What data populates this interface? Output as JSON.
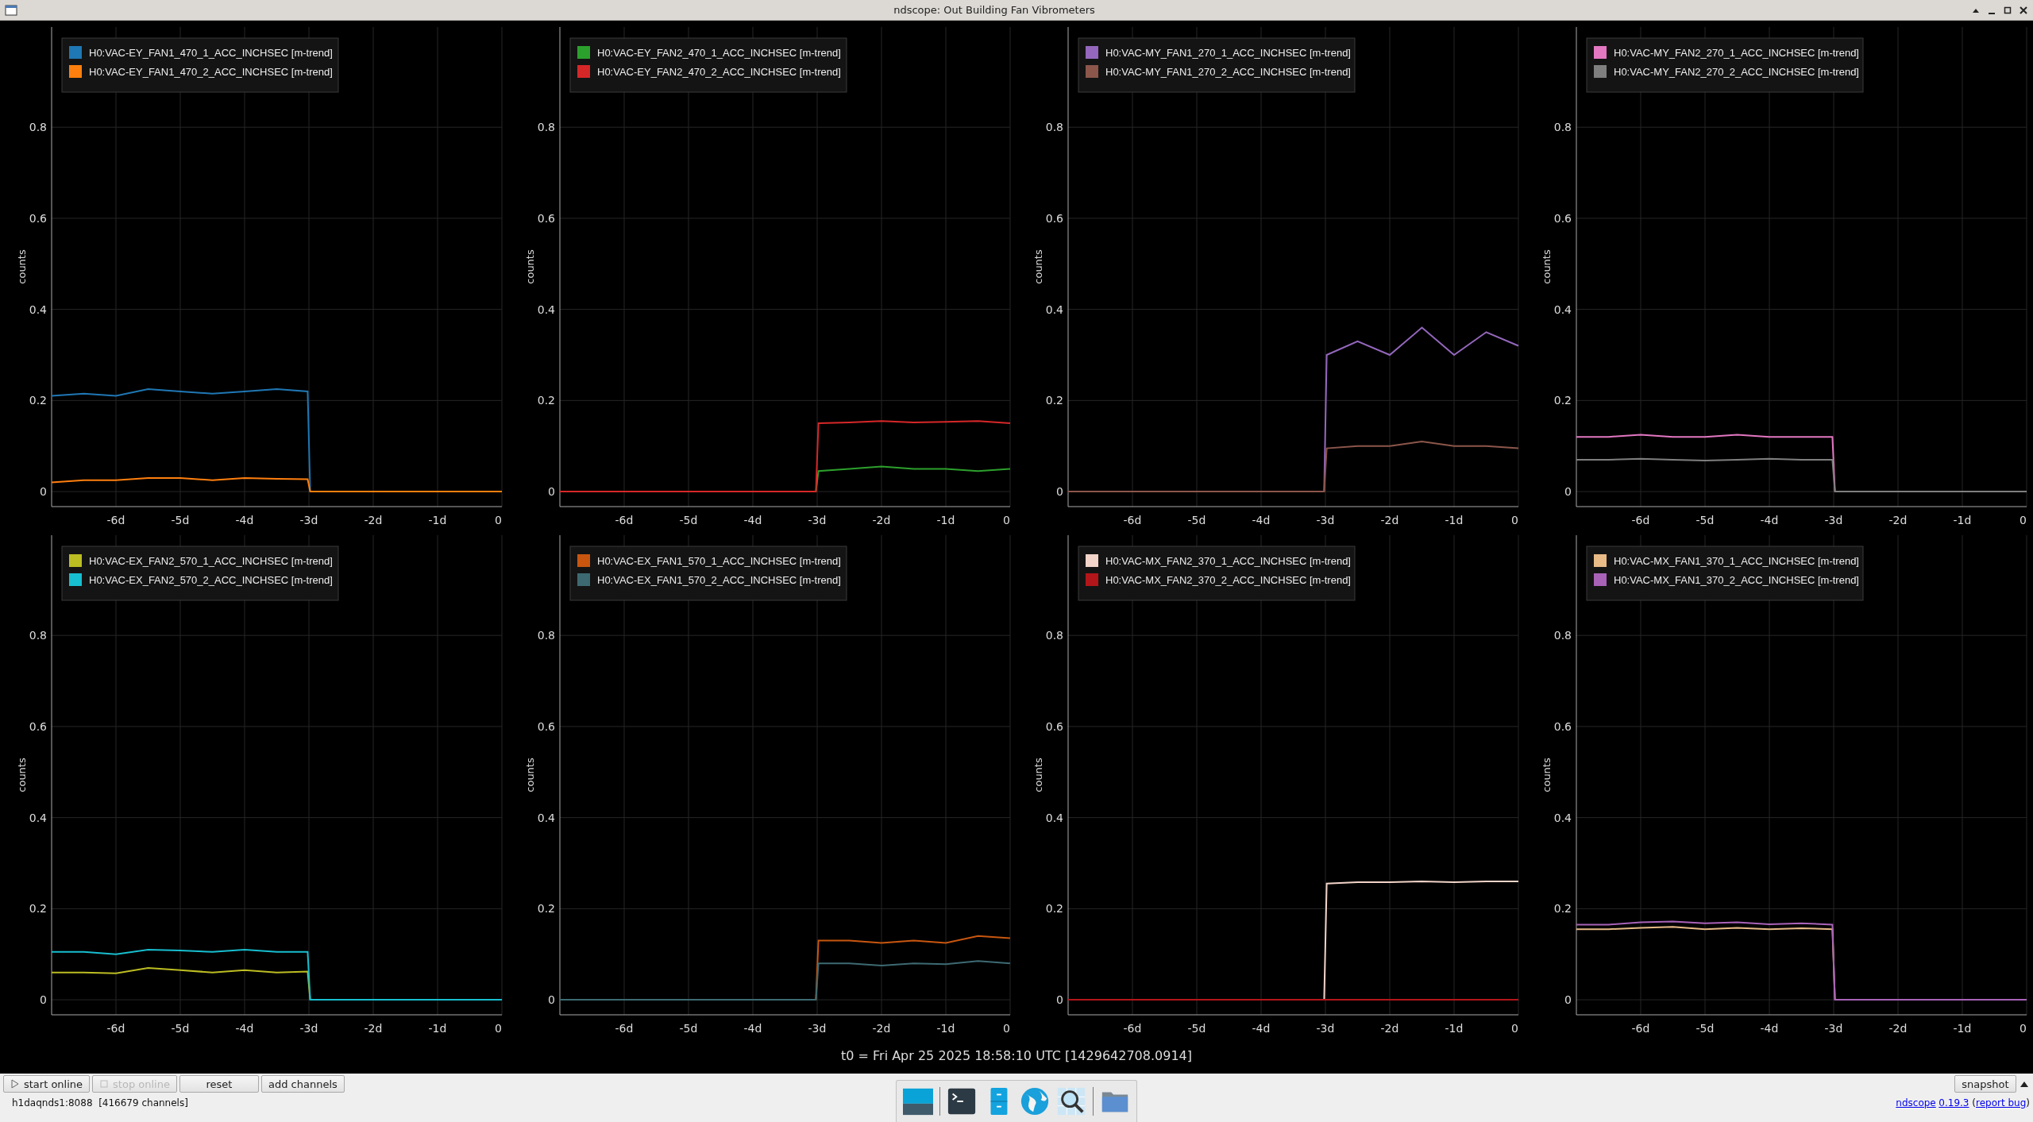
{
  "window": {
    "title": "ndscope: Out Building Fan Vibrometers"
  },
  "plots": [
    {
      "chart_data": {
        "type": "line",
        "ylabel": "counts",
        "grid": true,
        "legend": true,
        "xlim": [
          -7,
          0
        ],
        "ylim": [
          -0.033,
          1.02
        ],
        "x": [
          -7,
          -6.5,
          -6,
          -5.5,
          -5,
          -4.5,
          -4,
          -3.5,
          -3.02,
          -2.98,
          -2.5,
          -2,
          -1.5,
          -1,
          -0.5,
          0
        ],
        "xticks": [
          {
            "value": -6,
            "label": "-6d"
          },
          {
            "value": -5,
            "label": "-5d"
          },
          {
            "value": -4,
            "label": "-4d"
          },
          {
            "value": -3,
            "label": "-3d"
          },
          {
            "value": -2,
            "label": "-2d"
          },
          {
            "value": -1,
            "label": "-1d"
          },
          {
            "value": 0,
            "label": "0"
          }
        ],
        "yticks": [
          0,
          0.2,
          0.4,
          0.6,
          0.8
        ],
        "series": [
          {
            "name": "H0:VAC-EY_FAN1_470_1_ACC_INCHSEC [m-trend]",
            "color": "#1f77b4",
            "values": [
              0.21,
              0.215,
              0.21,
              0.225,
              0.22,
              0.215,
              0.22,
              0.225,
              0.22,
              0,
              null,
              null,
              null,
              null,
              null,
              null
            ]
          },
          {
            "name": "H0:VAC-EY_FAN1_470_2_ACC_INCHSEC [m-trend]",
            "color": "#ff7f0e",
            "values": [
              0.02,
              0.025,
              0.025,
              0.03,
              0.03,
              0.025,
              0.03,
              0.028,
              0.027,
              0,
              0,
              0,
              0,
              0,
              0,
              0
            ]
          }
        ]
      }
    },
    {
      "chart_data": {
        "type": "line",
        "ylabel": "counts",
        "grid": true,
        "legend": true,
        "xlim": [
          -7,
          0
        ],
        "ylim": [
          -0.033,
          1.02
        ],
        "x": [
          -7,
          -6.5,
          -6,
          -5.5,
          -5,
          -4.5,
          -4,
          -3.5,
          -3.02,
          -2.98,
          -2.5,
          -2,
          -1.5,
          -1,
          -0.5,
          0
        ],
        "xticks": [
          {
            "value": -6,
            "label": "-6d"
          },
          {
            "value": -5,
            "label": "-5d"
          },
          {
            "value": -4,
            "label": "-4d"
          },
          {
            "value": -3,
            "label": "-3d"
          },
          {
            "value": -2,
            "label": "-2d"
          },
          {
            "value": -1,
            "label": "-1d"
          },
          {
            "value": 0,
            "label": "0"
          }
        ],
        "yticks": [
          0,
          0.2,
          0.4,
          0.6,
          0.8
        ],
        "series": [
          {
            "name": "H0:VAC-EY_FAN2_470_1_ACC_INCHSEC [m-trend]",
            "color": "#2ca02c",
            "values": [
              null,
              null,
              null,
              null,
              null,
              null,
              null,
              null,
              0,
              0.045,
              0.05,
              0.055,
              0.05,
              0.05,
              0.045,
              0.05
            ]
          },
          {
            "name": "H0:VAC-EY_FAN2_470_2_ACC_INCHSEC [m-trend]",
            "color": "#d62728",
            "values": [
              0,
              0,
              0,
              0,
              0,
              0,
              0,
              0,
              0,
              0.15,
              0.152,
              0.155,
              0.152,
              0.153,
              0.155,
              0.15
            ]
          }
        ]
      }
    },
    {
      "chart_data": {
        "type": "line",
        "ylabel": "counts",
        "grid": true,
        "legend": true,
        "xlim": [
          -7,
          0
        ],
        "ylim": [
          -0.033,
          1.02
        ],
        "x": [
          -7,
          -6.5,
          -6,
          -5.5,
          -5,
          -4.5,
          -4,
          -3.5,
          -3.02,
          -2.98,
          -2.5,
          -2,
          -1.5,
          -1,
          -0.5,
          0
        ],
        "xticks": [
          {
            "value": -6,
            "label": "-6d"
          },
          {
            "value": -5,
            "label": "-5d"
          },
          {
            "value": -4,
            "label": "-4d"
          },
          {
            "value": -3,
            "label": "-3d"
          },
          {
            "value": -2,
            "label": "-2d"
          },
          {
            "value": -1,
            "label": "-1d"
          },
          {
            "value": 0,
            "label": "0"
          }
        ],
        "yticks": [
          0,
          0.2,
          0.4,
          0.6,
          0.8
        ],
        "series": [
          {
            "name": "H0:VAC-MY_FAN1_270_1_ACC_INCHSEC [m-trend]",
            "color": "#9467bd",
            "values": [
              null,
              null,
              null,
              null,
              null,
              null,
              null,
              null,
              0,
              0.3,
              0.33,
              0.3,
              0.36,
              0.3,
              0.35,
              0.32
            ]
          },
          {
            "name": "H0:VAC-MY_FAN1_270_2_ACC_INCHSEC [m-trend]",
            "color": "#8c564b",
            "values": [
              0,
              0,
              0,
              0,
              0,
              0,
              0,
              0,
              0,
              0.095,
              0.1,
              0.1,
              0.11,
              0.1,
              0.1,
              0.095
            ]
          }
        ]
      }
    },
    {
      "chart_data": {
        "type": "line",
        "ylabel": "counts",
        "grid": true,
        "legend": true,
        "xlim": [
          -7,
          0
        ],
        "ylim": [
          -0.033,
          1.02
        ],
        "x": [
          -7,
          -6.5,
          -6,
          -5.5,
          -5,
          -4.5,
          -4,
          -3.5,
          -3.02,
          -2.98,
          -2.5,
          -2,
          -1.5,
          -1,
          -0.5,
          0
        ],
        "xticks": [
          {
            "value": -6,
            "label": "-6d"
          },
          {
            "value": -5,
            "label": "-5d"
          },
          {
            "value": -4,
            "label": "-4d"
          },
          {
            "value": -3,
            "label": "-3d"
          },
          {
            "value": -2,
            "label": "-2d"
          },
          {
            "value": -1,
            "label": "-1d"
          },
          {
            "value": 0,
            "label": "0"
          }
        ],
        "yticks": [
          0,
          0.2,
          0.4,
          0.6,
          0.8
        ],
        "series": [
          {
            "name": "H0:VAC-MY_FAN2_270_1_ACC_INCHSEC [m-trend]",
            "color": "#e377c2",
            "values": [
              0.12,
              0.12,
              0.125,
              0.12,
              0.12,
              0.125,
              0.12,
              0.12,
              0.12,
              0,
              null,
              null,
              null,
              null,
              null,
              null
            ]
          },
          {
            "name": "H0:VAC-MY_FAN2_270_2_ACC_INCHSEC [m-trend]",
            "color": "#7f7f7f",
            "values": [
              0.07,
              0.07,
              0.072,
              0.07,
              0.068,
              0.07,
              0.072,
              0.07,
              0.07,
              0,
              0,
              0,
              0,
              0,
              0,
              0
            ]
          }
        ]
      }
    },
    {
      "chart_data": {
        "type": "line",
        "ylabel": "counts",
        "grid": true,
        "legend": true,
        "xlim": [
          -7,
          0
        ],
        "ylim": [
          -0.033,
          1.02
        ],
        "x": [
          -7,
          -6.5,
          -6,
          -5.5,
          -5,
          -4.5,
          -4,
          -3.5,
          -3.02,
          -2.98,
          -2.5,
          -2,
          -1.5,
          -1,
          -0.5,
          0
        ],
        "xticks": [
          {
            "value": -6,
            "label": "-6d"
          },
          {
            "value": -5,
            "label": "-5d"
          },
          {
            "value": -4,
            "label": "-4d"
          },
          {
            "value": -3,
            "label": "-3d"
          },
          {
            "value": -2,
            "label": "-2d"
          },
          {
            "value": -1,
            "label": "-1d"
          },
          {
            "value": 0,
            "label": "0"
          }
        ],
        "yticks": [
          0,
          0.2,
          0.4,
          0.6,
          0.8
        ],
        "series": [
          {
            "name": "H0:VAC-EX_FAN2_570_1_ACC_INCHSEC [m-trend]",
            "color": "#bcbd22",
            "values": [
              0.06,
              0.06,
              0.058,
              0.07,
              0.065,
              0.06,
              0.065,
              0.06,
              0.062,
              0,
              null,
              null,
              null,
              null,
              null,
              null
            ]
          },
          {
            "name": "H0:VAC-EX_FAN2_570_2_ACC_INCHSEC [m-trend]",
            "color": "#17becf",
            "values": [
              0.105,
              0.105,
              0.1,
              0.11,
              0.108,
              0.105,
              0.11,
              0.105,
              0.105,
              0,
              0,
              0,
              0,
              0,
              0,
              0
            ]
          }
        ]
      }
    },
    {
      "chart_data": {
        "type": "line",
        "ylabel": "counts",
        "grid": true,
        "legend": true,
        "xlim": [
          -7,
          0
        ],
        "ylim": [
          -0.033,
          1.02
        ],
        "x": [
          -7,
          -6.5,
          -6,
          -5.5,
          -5,
          -4.5,
          -4,
          -3.5,
          -3.02,
          -2.98,
          -2.5,
          -2,
          -1.5,
          -1,
          -0.5,
          0
        ],
        "xticks": [
          {
            "value": -6,
            "label": "-6d"
          },
          {
            "value": -5,
            "label": "-5d"
          },
          {
            "value": -4,
            "label": "-4d"
          },
          {
            "value": -3,
            "label": "-3d"
          },
          {
            "value": -2,
            "label": "-2d"
          },
          {
            "value": -1,
            "label": "-1d"
          },
          {
            "value": 0,
            "label": "0"
          }
        ],
        "yticks": [
          0,
          0.2,
          0.4,
          0.6,
          0.8
        ],
        "series": [
          {
            "name": "H0:VAC-EX_FAN1_570_1_ACC_INCHSEC [m-trend]",
            "color": "#c8560f",
            "values": [
              null,
              null,
              null,
              null,
              null,
              null,
              null,
              null,
              0,
              0.13,
              0.13,
              0.125,
              0.13,
              0.125,
              0.14,
              0.135
            ]
          },
          {
            "name": "H0:VAC-EX_FAN1_570_2_ACC_INCHSEC [m-trend]",
            "color": "#3d6a72",
            "values": [
              0,
              0,
              0,
              0,
              0,
              0,
              0,
              0,
              0,
              0.08,
              0.08,
              0.075,
              0.08,
              0.078,
              0.085,
              0.08
            ]
          }
        ]
      }
    },
    {
      "chart_data": {
        "type": "line",
        "ylabel": "counts",
        "grid": true,
        "legend": true,
        "xlim": [
          -7,
          0
        ],
        "ylim": [
          -0.033,
          1.02
        ],
        "x": [
          -7,
          -6.5,
          -6,
          -5.5,
          -5,
          -4.5,
          -4,
          -3.5,
          -3.02,
          -2.98,
          -2.5,
          -2,
          -1.5,
          -1,
          -0.5,
          0
        ],
        "xticks": [
          {
            "value": -6,
            "label": "-6d"
          },
          {
            "value": -5,
            "label": "-5d"
          },
          {
            "value": -4,
            "label": "-4d"
          },
          {
            "value": -3,
            "label": "-3d"
          },
          {
            "value": -2,
            "label": "-2d"
          },
          {
            "value": -1,
            "label": "-1d"
          },
          {
            "value": 0,
            "label": "0"
          }
        ],
        "yticks": [
          0,
          0.2,
          0.4,
          0.6,
          0.8
        ],
        "series": [
          {
            "name": "H0:VAC-MX_FAN2_370_1_ACC_INCHSEC [m-trend]",
            "color": "#f2d4c9",
            "values": [
              null,
              null,
              null,
              null,
              null,
              null,
              null,
              null,
              0,
              0.255,
              0.258,
              0.258,
              0.26,
              0.258,
              0.26,
              0.26
            ]
          },
          {
            "name": "H0:VAC-MX_FAN2_370_2_ACC_INCHSEC [m-trend]",
            "color": "#b3161a",
            "values": [
              0,
              0,
              0,
              0,
              0,
              0,
              0,
              0,
              0,
              0,
              0,
              0,
              0,
              0,
              0,
              0
            ]
          }
        ]
      }
    },
    {
      "chart_data": {
        "type": "line",
        "ylabel": "counts",
        "grid": true,
        "legend": true,
        "xlim": [
          -7,
          0
        ],
        "ylim": [
          -0.033,
          1.02
        ],
        "x": [
          -7,
          -6.5,
          -6,
          -5.5,
          -5,
          -4.5,
          -4,
          -3.5,
          -3.02,
          -2.98,
          -2.5,
          -2,
          -1.5,
          -1,
          -0.5,
          0
        ],
        "xticks": [
          {
            "value": -6,
            "label": "-6d"
          },
          {
            "value": -5,
            "label": "-5d"
          },
          {
            "value": -4,
            "label": "-4d"
          },
          {
            "value": -3,
            "label": "-3d"
          },
          {
            "value": -2,
            "label": "-2d"
          },
          {
            "value": -1,
            "label": "-1d"
          },
          {
            "value": 0,
            "label": "0"
          }
        ],
        "yticks": [
          0,
          0.2,
          0.4,
          0.6,
          0.8
        ],
        "series": [
          {
            "name": "H0:VAC-MX_FAN1_370_1_ACC_INCHSEC [m-trend]",
            "color": "#e8bb87",
            "values": [
              0.155,
              0.155,
              0.158,
              0.16,
              0.155,
              0.158,
              0.155,
              0.157,
              0.155,
              0,
              null,
              null,
              null,
              null,
              null,
              null
            ]
          },
          {
            "name": "H0:VAC-MX_FAN1_370_2_ACC_INCHSEC [m-trend]",
            "color": "#a862b8",
            "values": [
              0.165,
              0.165,
              0.17,
              0.172,
              0.168,
              0.17,
              0.166,
              0.168,
              0.165,
              0,
              0,
              0,
              0,
              0,
              0,
              0
            ]
          }
        ]
      }
    }
  ],
  "t0": "t0 = Fri Apr 25 2025 18:58:10 UTC [1429642708.0914]",
  "toolbar": {
    "buttons": [
      {
        "label": "start online",
        "kind": "play",
        "disabled": false
      },
      {
        "label": "stop online",
        "kind": "stop",
        "disabled": true
      },
      {
        "label": "reset",
        "kind": "plain",
        "disabled": false
      },
      {
        "label": "add channels",
        "kind": "plain",
        "disabled": false
      }
    ],
    "snapshot": "snapshot"
  },
  "status": "h1daqnds1:8088  [416679 channels]",
  "about": [
    {
      "kind": "link",
      "text": "ndscope"
    },
    {
      "kind": "link",
      "text": "0.19.3"
    },
    {
      "kind": "plain",
      "text": " ("
    },
    {
      "kind": "link",
      "text": "report bug"
    },
    {
      "kind": "plain",
      "text": ")"
    }
  ]
}
